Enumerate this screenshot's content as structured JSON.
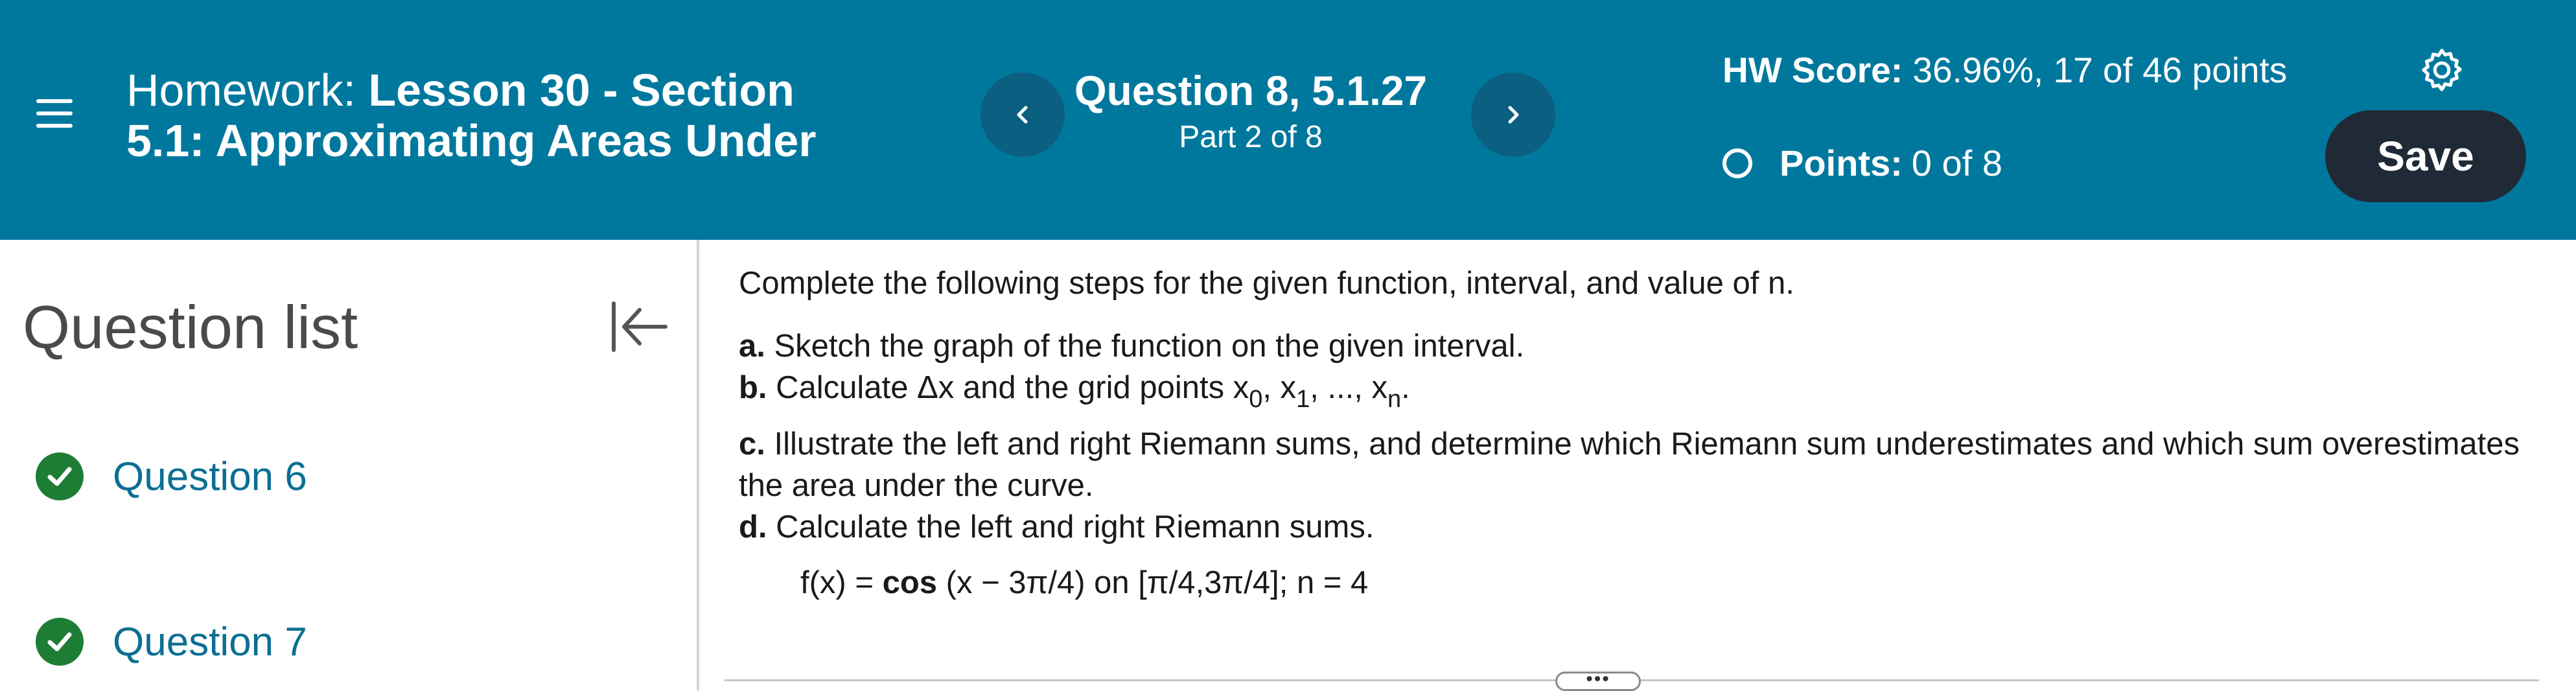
{
  "header": {
    "homework_prefix": "Homework: ",
    "homework_title": "Lesson 30 - Section 5.1: Approximating Areas Under",
    "question_title": "Question 8, 5.1.27",
    "question_part": "Part 2 of 8",
    "hw_score_label": "HW Score:",
    "hw_score_value": " 36.96%, 17 of 46 points",
    "points_label": "Points:",
    "points_value": "0 of 8",
    "save_label": "Save"
  },
  "sidebar": {
    "title": "Question list",
    "items": [
      {
        "label": "Question 6",
        "status": "complete"
      },
      {
        "label": "Question 7",
        "status": "complete"
      }
    ]
  },
  "question": {
    "intro": "Complete the following steps for the given function, interval, and value of n.",
    "a_label": "a.",
    "a_text": " Sketch the graph of the function on the given interval.",
    "b_label": "b.",
    "b_text": " Calculate Δx and the grid points x",
    "b_sub0": "0",
    "b_sep1": ", x",
    "b_sub1": "1",
    "b_sep2": ", ..., x",
    "b_subn": "n",
    "b_end": ".",
    "c_label": "c.",
    "c_text": " Illustrate the left and right Riemann sums, and determine which Riemann sum underestimates and which sum overestimates the area under the curve.",
    "d_label": "d.",
    "d_text": " Calculate the left and right Riemann sums.",
    "func_pre": "f(x) = ",
    "func_bold": "cos",
    "func_post": " (x − 3π/4) on [π/4,3π/4]; n = 4"
  },
  "drag_handle": "•••",
  "colors": {
    "header_bg": "#00789e",
    "nav_button": "#0b5f80",
    "save_button": "#1f2a36",
    "check_green": "#1e7d34",
    "link_blue": "#0b6f93"
  }
}
